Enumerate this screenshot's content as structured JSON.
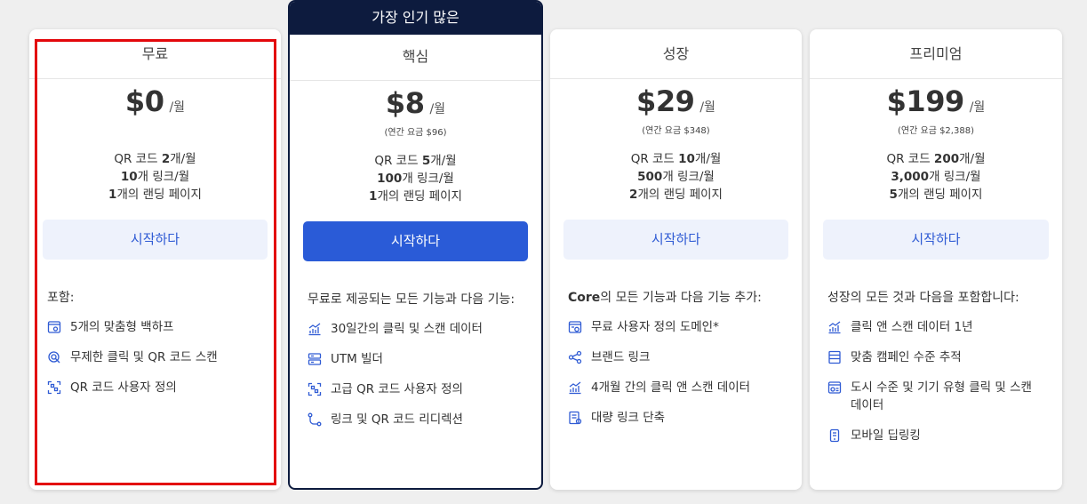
{
  "colors": {
    "page_bg": "#efefef",
    "card_bg": "#ffffff",
    "navy": "#0d1b3e",
    "primary_button": "#2a5bd7",
    "secondary_button_bg": "#eef2fc",
    "secondary_button_text": "#2f5bd4",
    "icon_blue": "#2f5bd4",
    "highlight_red": "#e3070b"
  },
  "plans": [
    {
      "name": "무료",
      "price": "$0",
      "per": "/월",
      "annual": "",
      "limits": [
        {
          "num": "2",
          "pre": "QR 코드 ",
          "post": "개/월"
        },
        {
          "num": "10",
          "pre": "",
          "post": "개 링크/월"
        },
        {
          "num": "1",
          "pre": "",
          "post": "개의 랜딩 페이지"
        }
      ],
      "cta": "시작하다",
      "features_title": "포함:",
      "features_title_bold": "",
      "features": [
        {
          "icon": "page-customize-icon",
          "text": "5개의 맞춤형 백하프"
        },
        {
          "icon": "click-target-icon",
          "text": "무제한 클릭 및 QR 코드 스캔"
        },
        {
          "icon": "qr-scan-icon",
          "text": "QR 코드 사용자 정의"
        }
      ]
    },
    {
      "name": "핵심",
      "banner": "가장 인기 많은",
      "price": "$8",
      "per": "/월",
      "annual": "(연간 요금 $96)",
      "limits": [
        {
          "num": "5",
          "pre": "QR 코드 ",
          "post": "개/월"
        },
        {
          "num": "100",
          "pre": "",
          "post": "개 링크/월"
        },
        {
          "num": "1",
          "pre": "",
          "post": "개의 랜딩 페이지"
        }
      ],
      "cta": "시작하다",
      "features_title": "무료로 제공되는 모든 기능과 다음 기능:",
      "features_title_bold": "",
      "features": [
        {
          "icon": "analytics-chart-icon",
          "text": "30일간의 클릭 및 스캔 데이터"
        },
        {
          "icon": "utm-builder-icon",
          "text": "UTM 빌더"
        },
        {
          "icon": "qr-scan-icon",
          "text": "고급 QR 코드 사용자 정의"
        },
        {
          "icon": "redirect-icon",
          "text": "링크 및 QR 코드 리디렉션"
        }
      ]
    },
    {
      "name": "성장",
      "price": "$29",
      "per": "/월",
      "annual": "(연간 요금 $348)",
      "limits": [
        {
          "num": "10",
          "pre": "QR 코드 ",
          "post": "개/월"
        },
        {
          "num": "500",
          "pre": "",
          "post": "개 링크/월"
        },
        {
          "num": "2",
          "pre": "",
          "post": "개의 랜딩 페이지"
        }
      ],
      "cta": "시작하다",
      "features_title": "의 모든 기능과 다음 기능 추가:",
      "features_title_bold": "Core",
      "features": [
        {
          "icon": "domain-icon",
          "text": "무료 사용자 정의 도메인*"
        },
        {
          "icon": "share-icon",
          "text": "브랜드 링크"
        },
        {
          "icon": "analytics-chart-icon",
          "text": "4개월 간의 클릭 앤 스캔 데이터"
        },
        {
          "icon": "bulk-shorten-icon",
          "text": "대량 링크 단축"
        }
      ]
    },
    {
      "name": "프리미엄",
      "price": "$199",
      "per": "/월",
      "annual": "(연간 요금 $2,388)",
      "limits": [
        {
          "num": "200",
          "pre": "QR 코드 ",
          "post": "개/월"
        },
        {
          "num": "3,000",
          "pre": "",
          "post": "개 링크/월"
        },
        {
          "num": "5",
          "pre": "",
          "post": "개의 랜딩 페이지"
        }
      ],
      "cta": "시작하다",
      "features_title": "성장의 모든 것과 다음을 포함합니다:",
      "features_title_bold": "",
      "features": [
        {
          "icon": "analytics-chart-icon",
          "text": "클릭 앤 스캔 데이터 1년"
        },
        {
          "icon": "campaign-list-icon",
          "text": "맞춤 캠페인 수준 추적"
        },
        {
          "icon": "device-browser-icon",
          "text": "도시 수준 및 기기 유형 클릭 및 스캔 데이터"
        },
        {
          "icon": "mobile-deeplink-icon",
          "text": "모바일 딥링킹"
        }
      ]
    }
  ]
}
